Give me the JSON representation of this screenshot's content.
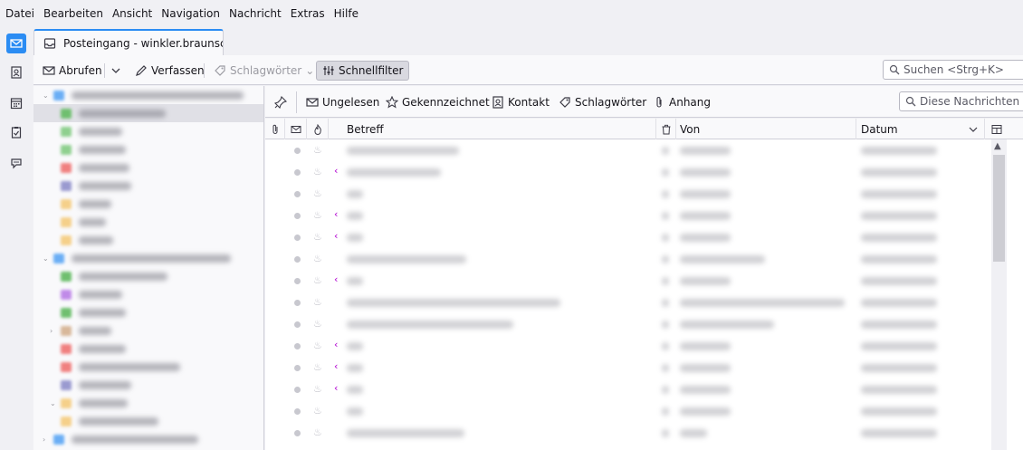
{
  "menu": [
    {
      "label": "Datei"
    },
    {
      "label": "Bearbeiten"
    },
    {
      "label": "Ansicht"
    },
    {
      "label": "Navigation"
    },
    {
      "label": "Nachricht"
    },
    {
      "label": "Extras"
    },
    {
      "label": "Hilfe"
    }
  ],
  "tab": {
    "title": "Posteingang - winkler.braunsch"
  },
  "toolbar": {
    "fetch": "Abrufen",
    "compose": "Verfassen",
    "tags": "Schlagwörter",
    "quickfilter": "Schnellfilter",
    "search_placeholder": "Suchen <Strg+K>"
  },
  "quickfilter": {
    "unread": "Ungelesen",
    "starred": "Gekennzeichnet",
    "contact": "Kontakt",
    "tags": "Schlagwörter",
    "attachment": "Anhang",
    "search_placeholder": "Diese Nachrichten du"
  },
  "columns": {
    "subject": "Betreff",
    "from": "Von",
    "date": "Datum"
  },
  "accent": "#2b8cf3"
}
